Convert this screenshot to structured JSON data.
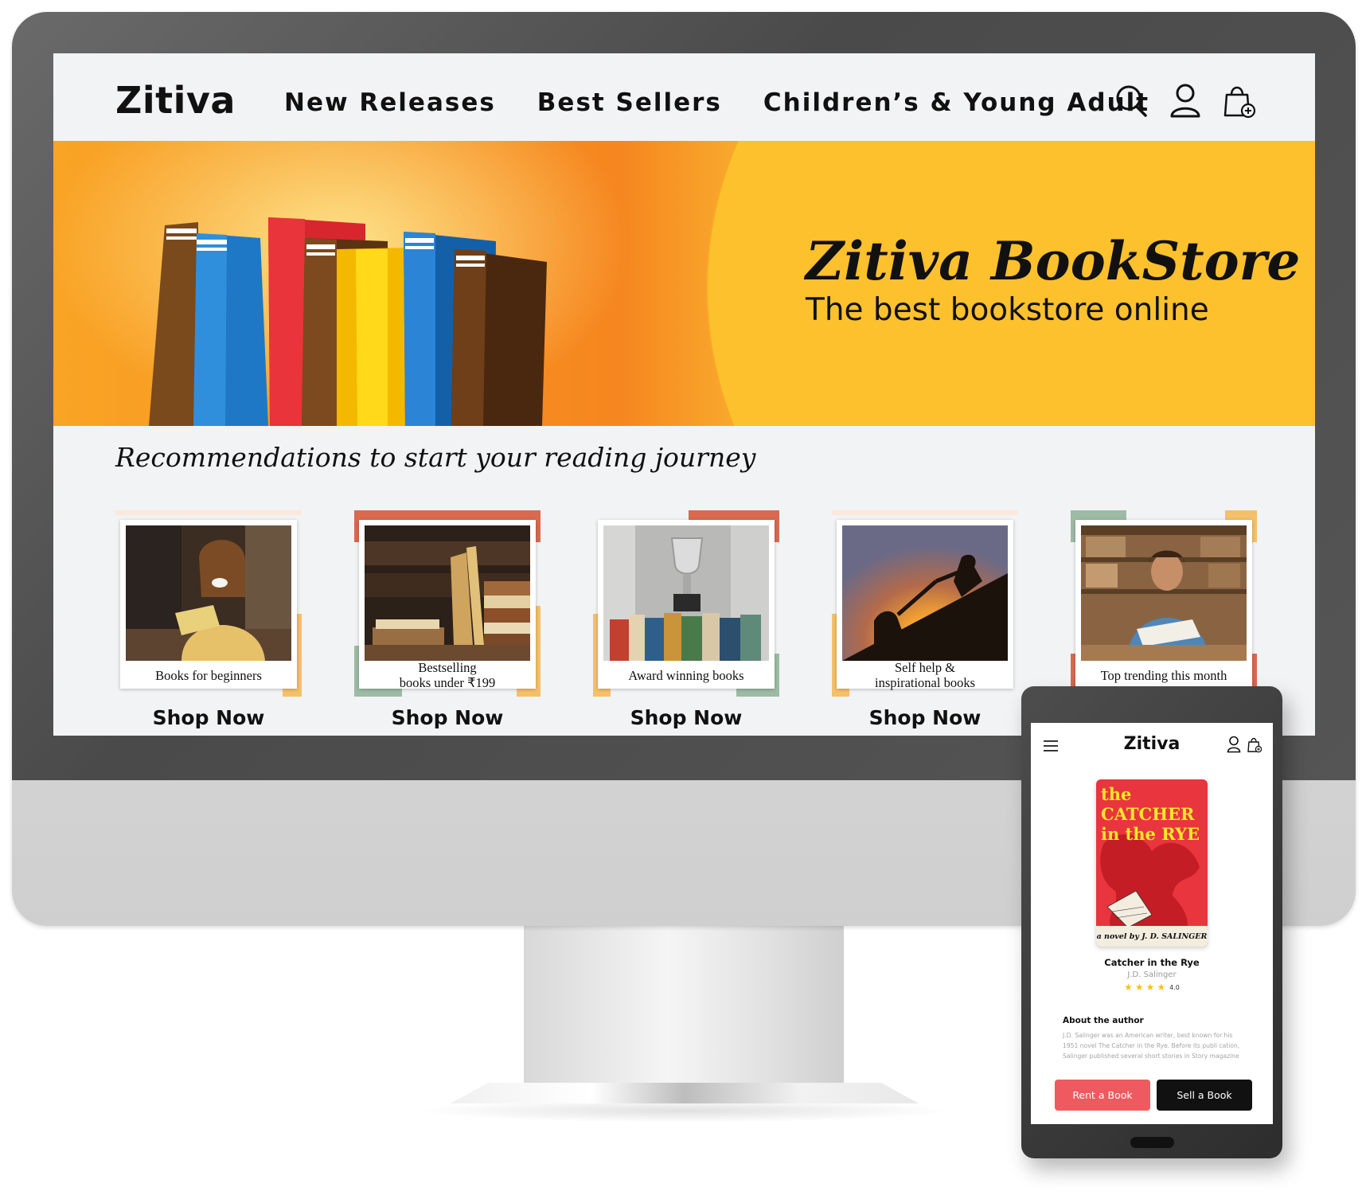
{
  "colors": {
    "accent_red": "#ee5a5f",
    "banner_orange": "#f6861f",
    "banner_yellow": "#fdc12e",
    "text_dark": "#111111",
    "star_yellow": "#f6c21a"
  },
  "desktop": {
    "header": {
      "logo": "Zitiva",
      "nav": [
        "New Releases",
        "Best Sellers",
        "Children’s & Young Adult"
      ],
      "icons": [
        "search-icon",
        "user-icon",
        "shopping-bag-add-icon"
      ]
    },
    "banner": {
      "title": "Zitiva BookStore",
      "subtitle": "The best bookstore online"
    },
    "recommendations": {
      "title": "Recommendations to start your reading journey",
      "cards": [
        {
          "label": "Books for beginners",
          "cta": "Shop Now"
        },
        {
          "label": "Bestselling\nbooks under ₹199",
          "cta": "Shop Now"
        },
        {
          "label": "Award winning books",
          "cta": "Shop Now"
        },
        {
          "label": "Self help &\ninspirational books",
          "cta": "Shop Now"
        },
        {
          "label": "Top trending this month",
          "cta": ""
        }
      ]
    }
  },
  "mobile": {
    "logo": "Zitiva",
    "icons": [
      "menu-icon",
      "user-icon",
      "shopping-bag-add-icon"
    ],
    "book": {
      "cover_title": "the CATCHER\nin the RYE",
      "cover_author": "a novel by J. D. SALINGER",
      "title": "Catcher in the Rye",
      "author": "J.D. Salinger",
      "rating": 4,
      "rating_label": "4.0"
    },
    "about": {
      "heading": "About the author",
      "text": "J.D. Salinger was an American writer, best known for his 1951 novel The Catcher in the Rye. Before its publi cation, Salinger published several short stories in Story magazine"
    },
    "buttons": {
      "rent": "Rent a Book",
      "sell": "Sell a Book"
    }
  }
}
